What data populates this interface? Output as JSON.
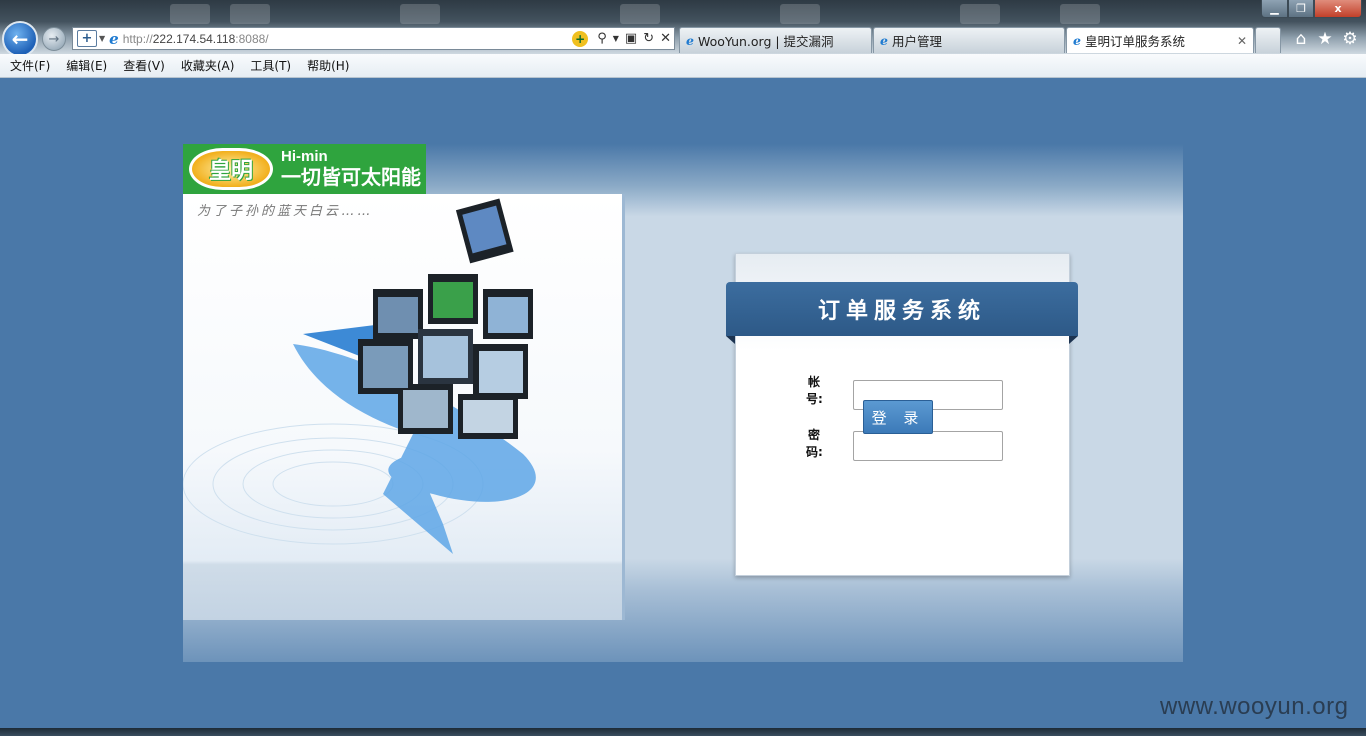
{
  "browser": {
    "address": {
      "protocol": "http://",
      "host": "222.174.54.118",
      "port": ":8088/"
    },
    "tabs": [
      {
        "label": "WooYun.org | 提交漏洞"
      },
      {
        "label": "用户管理"
      },
      {
        "label": "皇明订单服务系统"
      }
    ],
    "window_controls": {
      "close": "x"
    }
  },
  "menu": {
    "items": [
      "文件(F)",
      "编辑(E)",
      "查看(V)",
      "收藏夹(A)",
      "工具(T)",
      "帮助(H)"
    ]
  },
  "page": {
    "logo": {
      "badge": "皇明",
      "brand_en": "Hi-min",
      "brand_cn": "一切皆可太阳能"
    },
    "slogan": "为了子孙的蓝天白云……",
    "login": {
      "title": "订单服务系统",
      "account_label_1": "帐",
      "account_label_2": "号:",
      "password_label_1": "密",
      "password_label_2": "码:",
      "submit_label": "登 录"
    }
  },
  "watermark": "www.wooyun.org"
}
